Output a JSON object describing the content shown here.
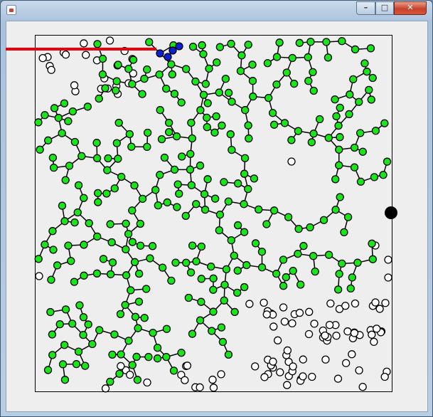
{
  "window": {
    "title": "",
    "controls": {
      "minimize_icon": "minimize-icon",
      "maximize_icon": "maximize-icon",
      "close_icon": "close-icon"
    }
  },
  "colors": {
    "client_background": "#eeeeee",
    "tree_node": "#19e619",
    "path_node": "#0b1fd6",
    "unvisited_node": "#ffffff",
    "goal_node": "#000000",
    "progress_line": "#e8000a",
    "edge": "#000000"
  },
  "scene": {
    "progress_line_fraction": 0.42
  }
}
